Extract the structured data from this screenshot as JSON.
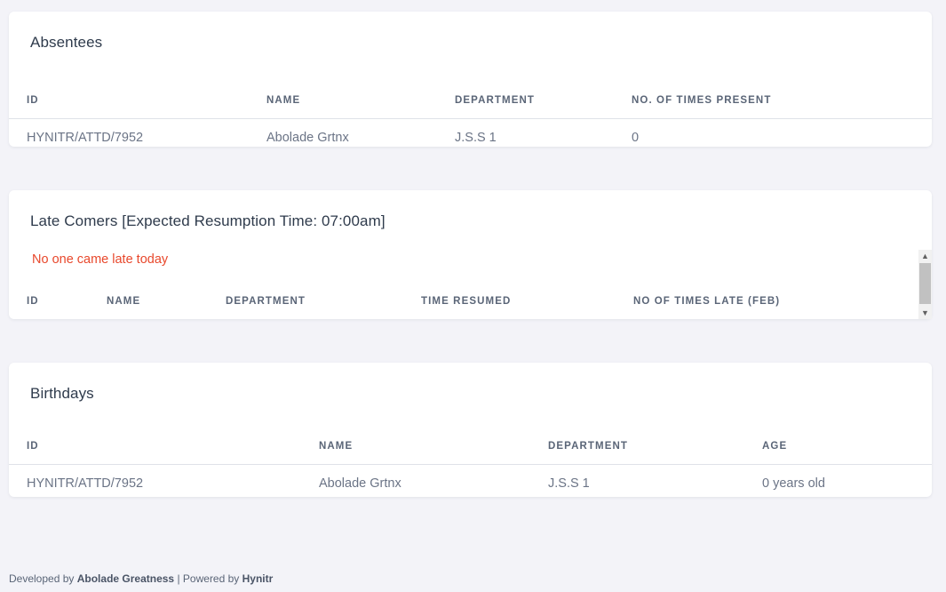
{
  "absentees": {
    "title": "Absentees",
    "columns": [
      "ID",
      "NAME",
      "DEPARTMENT",
      "NO. OF TIMES PRESENT"
    ],
    "rows": [
      [
        "HYNITR/ATTD/7952",
        "Abolade Grtnx",
        "J.S.S 1",
        "0"
      ]
    ]
  },
  "late_comers": {
    "title": "Late Comers [Expected Resumption Time: 07:00am]",
    "empty_message": "No one came late today",
    "columns": [
      "ID",
      "NAME",
      "DEPARTMENT",
      "TIME RESUMED",
      "NO OF TIMES LATE (FEB)"
    ]
  },
  "birthdays": {
    "title": "Birthdays",
    "columns": [
      "ID",
      "NAME",
      "DEPARTMENT",
      "AGE"
    ],
    "rows": [
      [
        "HYNITR/ATTD/7952",
        "Abolade Grtnx",
        "J.S.S 1",
        "0 years old"
      ]
    ]
  },
  "footer": {
    "developed_prefix": "Developed by",
    "developer": "Abolade Greatness",
    "separator": "|",
    "powered_prefix": "Powered by",
    "powered_by": "Hynitr"
  },
  "colors": {
    "background": "#f3f3f8",
    "card": "#ffffff",
    "empty_message": "#e8482c"
  }
}
